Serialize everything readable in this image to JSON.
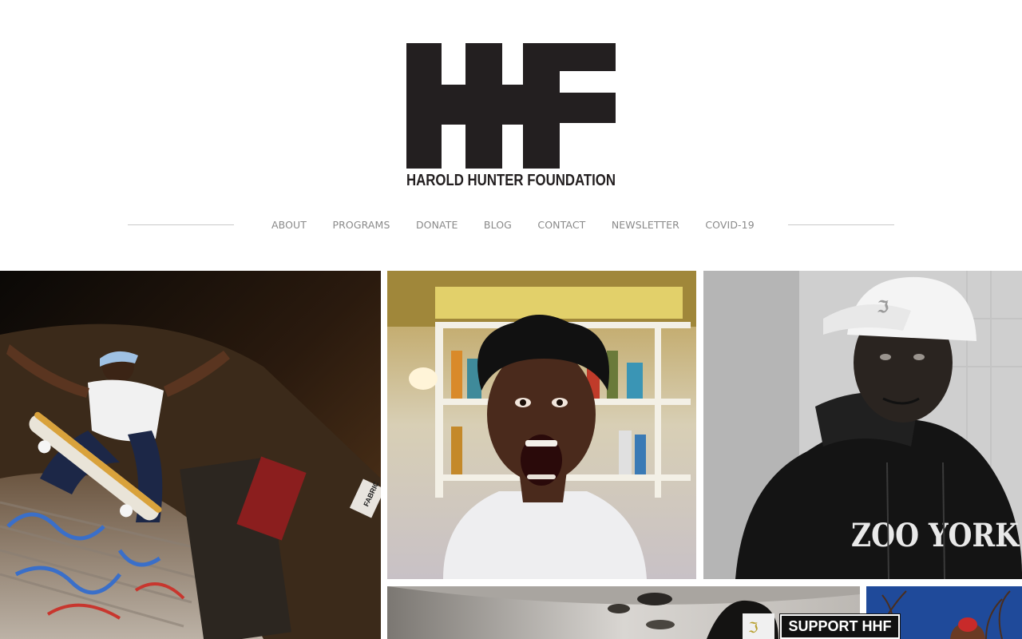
{
  "brand": {
    "logo_icon": "hhf-monogram",
    "wordmark": "HAROLD HUNTER FOUNDATION",
    "color": "#231f20"
  },
  "nav": {
    "items": [
      {
        "label": "ABOUT"
      },
      {
        "label": "PROGRAMS"
      },
      {
        "label": "DONATE"
      },
      {
        "label": "BLOG"
      },
      {
        "label": "CONTACT"
      },
      {
        "label": "NEWSLETTER"
      },
      {
        "label": "COVID-19"
      }
    ]
  },
  "gallery": {
    "photos": [
      {
        "name": "skater-photo",
        "overlay_text": "FABRIC"
      },
      {
        "name": "screaming-portrait-photo"
      },
      {
        "name": "white-cap-portrait-photo",
        "overlay_text": "ZOO YORK"
      },
      {
        "name": "bottom-left-photo"
      },
      {
        "name": "bottom-right-photo"
      }
    ]
  },
  "support": {
    "label": "SUPPORT HHF",
    "bg_color": "#111111",
    "text_color": "#ffffff"
  }
}
